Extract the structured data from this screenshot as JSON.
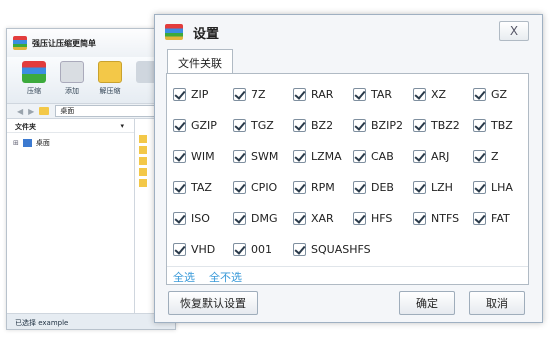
{
  "main_window": {
    "title": "强压让压缩更简单",
    "toolbar": [
      {
        "label": "压缩",
        "icon": "compress-icon"
      },
      {
        "label": "添加",
        "icon": "add-icon"
      },
      {
        "label": "解压缩",
        "icon": "extract-icon"
      }
    ],
    "address": "桌面",
    "tree_header": "文件夹",
    "tree_items": [
      "桌面"
    ],
    "status": "已选择 example"
  },
  "dialog": {
    "title": "设置",
    "close": "X",
    "tab": "文件关联",
    "formats": [
      {
        "label": "ZIP",
        "checked": true
      },
      {
        "label": "7Z",
        "checked": true
      },
      {
        "label": "RAR",
        "checked": true
      },
      {
        "label": "TAR",
        "checked": true
      },
      {
        "label": "XZ",
        "checked": true
      },
      {
        "label": "GZ",
        "checked": true
      },
      {
        "label": "GZIP",
        "checked": true
      },
      {
        "label": "TGZ",
        "checked": true
      },
      {
        "label": "BZ2",
        "checked": true
      },
      {
        "label": "BZIP2",
        "checked": true
      },
      {
        "label": "TBZ2",
        "checked": true
      },
      {
        "label": "TBZ",
        "checked": true
      },
      {
        "label": "WIM",
        "checked": true
      },
      {
        "label": "SWM",
        "checked": true
      },
      {
        "label": "LZMA",
        "checked": true
      },
      {
        "label": "CAB",
        "checked": true
      },
      {
        "label": "ARJ",
        "checked": true
      },
      {
        "label": "Z",
        "checked": true
      },
      {
        "label": "TAZ",
        "checked": true
      },
      {
        "label": "CPIO",
        "checked": true
      },
      {
        "label": "RPM",
        "checked": true
      },
      {
        "label": "DEB",
        "checked": true
      },
      {
        "label": "LZH",
        "checked": true
      },
      {
        "label": "LHA",
        "checked": true
      },
      {
        "label": "ISO",
        "checked": true
      },
      {
        "label": "DMG",
        "checked": true
      },
      {
        "label": "XAR",
        "checked": true
      },
      {
        "label": "HFS",
        "checked": true
      },
      {
        "label": "NTFS",
        "checked": true
      },
      {
        "label": "FAT",
        "checked": true
      },
      {
        "label": "VHD",
        "checked": true
      },
      {
        "label": "001",
        "checked": true
      },
      {
        "label": "SQUASHFS",
        "checked": true
      }
    ],
    "select_all": "全选",
    "select_none": "全不选",
    "restore_defaults": "恢复默认设置",
    "ok": "确定",
    "cancel": "取消"
  }
}
